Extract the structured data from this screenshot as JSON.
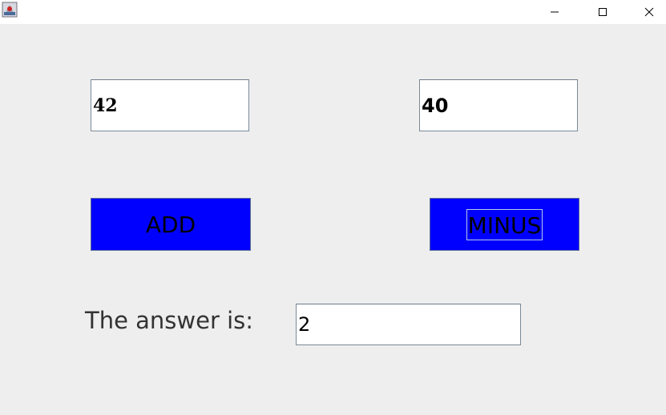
{
  "window": {
    "icon": "java-app-icon",
    "controls": {
      "minimize_icon": "minimize-icon",
      "maximize_icon": "maximize-icon",
      "close_icon": "close-icon"
    }
  },
  "inputs": {
    "first_number": "42",
    "second_number": "40"
  },
  "buttons": {
    "add_label": "ADD",
    "minus_label": "MINUS"
  },
  "result": {
    "label": "The answer is:",
    "value": "2"
  },
  "colors": {
    "background": "#eeeeee",
    "button_fill": "#0000ff",
    "field_fill": "#ffffff"
  }
}
